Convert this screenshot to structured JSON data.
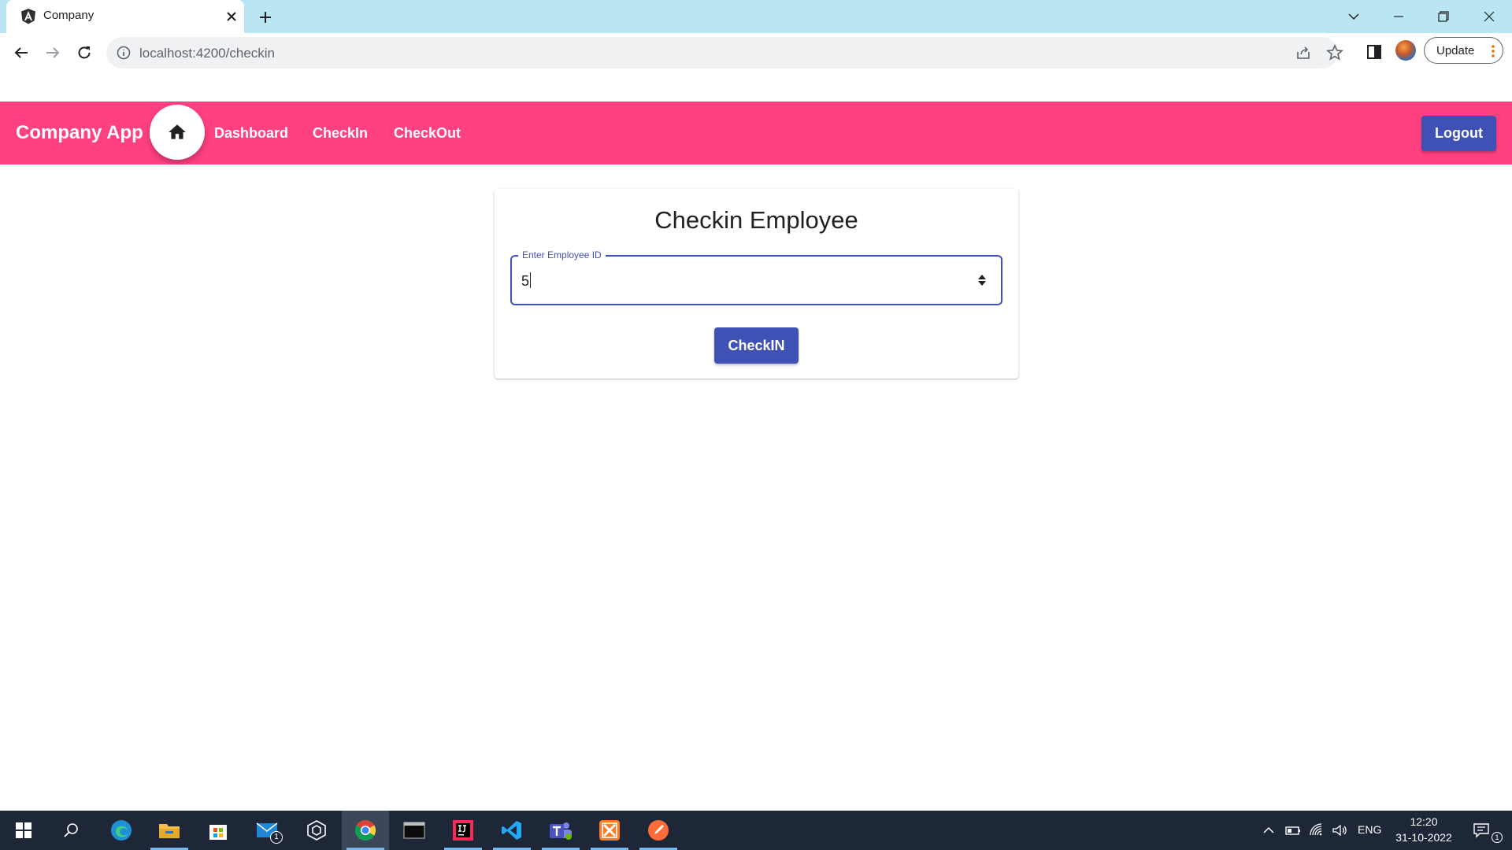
{
  "browser": {
    "tab": {
      "title": "Company",
      "favicon": "angular-icon"
    },
    "url": "localhost:4200/checkin",
    "update_label": "Update"
  },
  "navbar": {
    "brand": "Company App .",
    "home_icon": "home-icon",
    "links": [
      "Dashboard",
      "CheckIn",
      "CheckOut"
    ],
    "logout_label": "Logout"
  },
  "card": {
    "title": "Checkin Employee",
    "field_label": "Enter Employee ID",
    "field_value": "5",
    "submit_label": "CheckIN"
  },
  "taskbar": {
    "apps": [
      "windows-start-icon",
      "search-icon",
      "edge-icon",
      "file-explorer-icon",
      "store-icon",
      "mail-icon",
      "settings-cube-icon",
      "chrome-icon",
      "terminal-icon",
      "intellij-icon",
      "vscode-icon",
      "teams-icon",
      "xampp-icon",
      "postman-icon"
    ],
    "mail_badge": "1",
    "language": "ENG",
    "time": "12:20",
    "date": "31-10-2022",
    "notification_badge": "1"
  },
  "colors": {
    "navbar": "#ff4081",
    "primary": "#3f51b5",
    "tabstrip": "#b9e6f2",
    "taskbar": "#1d2738"
  }
}
